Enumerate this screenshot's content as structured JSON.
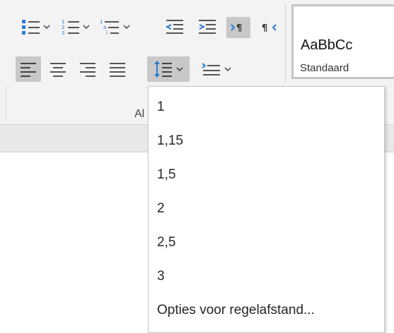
{
  "ribbon": {
    "group_label": "Al",
    "styles": {
      "sample_text": "AaBbCc",
      "style_name": "Standaard"
    },
    "buttons": [
      {
        "name": "bullets-button",
        "icon": "bullet-list-icon"
      },
      {
        "name": "numbering-button",
        "icon": "numbered-list-icon"
      },
      {
        "name": "multilevel-list-button",
        "icon": "multilevel-list-icon"
      },
      {
        "name": "decrease-indent-button",
        "icon": "decrease-indent-icon"
      },
      {
        "name": "increase-indent-button",
        "icon": "increase-indent-icon"
      },
      {
        "name": "ltr-button",
        "icon": "left-to-right-icon"
      },
      {
        "name": "rtl-button",
        "icon": "right-to-left-icon"
      },
      {
        "name": "align-left-button",
        "icon": "align-left-icon"
      },
      {
        "name": "center-button",
        "icon": "align-center-icon"
      },
      {
        "name": "align-right-button",
        "icon": "align-right-icon"
      },
      {
        "name": "justify-button",
        "icon": "justify-icon"
      },
      {
        "name": "line-spacing-button",
        "icon": "line-spacing-icon"
      },
      {
        "name": "indent-menu-button",
        "icon": "indent-icon"
      }
    ],
    "colors": {
      "accent_blue": "#2b7cd3",
      "icon_gray": "#555555",
      "active_bg": "#c8c8c8"
    }
  },
  "line_spacing_menu": {
    "items": [
      "1",
      "1,15",
      "1,5",
      "2",
      "2,5",
      "3",
      "Opties voor regelafstand..."
    ]
  }
}
